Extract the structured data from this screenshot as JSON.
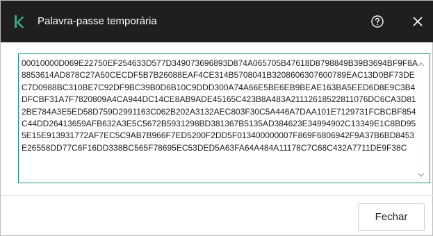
{
  "window": {
    "title": "Palavra-passe temporária",
    "logo_icon": "kaspersky-k-icon",
    "help_icon": "question-circle-icon",
    "close_icon": "close-x-icon"
  },
  "password_box": {
    "value": "00010000D069E22750EF254633D577D349073696893D874A065705B47618D8798849B39B3694BF9F8A8853614AD878C27A50CECDF5B7B26088EAF4CE314B5708041B3208606307600789EAC13D0BF73DEC7D0988BC310BE7C92DF9BC39B0D6B10C9DDD300A74A66E5BE6EB9BEAE163BA5EED6D8E9C3B4DFCBF31A7F7820809A4CA944DC14CE8AB9ADE45165C423B8A483A21112618522811076DC6CA3D812BE784A3E5ED58D759D2991163C062B202A3132AEC803F30C5A446A7DAA101E7129731FCBCBF854C44DD26413659AFB632A3E5C5672B5931298BD381367B5135AD384623E34994902C13349E1C8BD955E15E913931772AF7EC5C9AB7B966F7ED5200F2DD5F013400000007F869F6806942F9A37B6BD8453E26558DD77C6F16DD338BC565F78695EC53DED5A63FA64A484A11178C7C68C432A7711DE9F38C"
  },
  "footer": {
    "close_label": "Fechar"
  },
  "colors": {
    "titlebar": "#1f1f1f",
    "accent": "#1f8f73",
    "logo": "#3ca68a"
  }
}
